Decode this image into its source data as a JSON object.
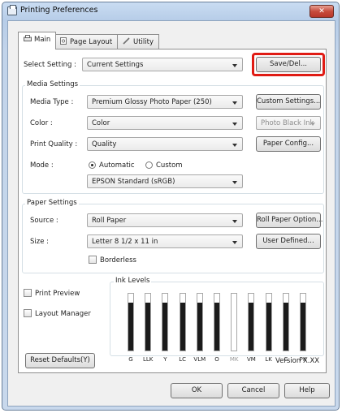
{
  "window": {
    "title": "Printing Preferences",
    "close_glyph": "✕"
  },
  "tabs": [
    {
      "label": "Main",
      "icon": "printer-icon"
    },
    {
      "label": "Page Layout",
      "icon": "page-layout-icon"
    },
    {
      "label": "Utility",
      "icon": "wrench-icon"
    }
  ],
  "select_setting": {
    "label": "Select Setting :",
    "value": "Current Settings",
    "save_del": "Save/Del..."
  },
  "media_settings": {
    "title": "Media Settings",
    "media_type_label": "Media Type :",
    "media_type_value": "Premium Glossy Photo Paper (250)",
    "custom_settings": "Custom Settings...",
    "color_label": "Color :",
    "color_value": "Color",
    "black_ink_value": "Photo Black Ink",
    "print_quality_label": "Print Quality :",
    "print_quality_value": "Quality",
    "paper_config": "Paper Config...",
    "mode_label": "Mode :",
    "mode_automatic": "Automatic",
    "mode_custom": "Custom",
    "mode_value": "EPSON Standard (sRGB)"
  },
  "paper_settings": {
    "title": "Paper Settings",
    "source_label": "Source :",
    "source_value": "Roll Paper",
    "roll_paper_option": "Roll Paper Option...",
    "size_label": "Size :",
    "size_value": "Letter 8 1/2 x 11 in",
    "user_defined": "User Defined...",
    "borderless": "Borderless"
  },
  "options": {
    "print_preview": "Print Preview",
    "layout_manager": "Layout Manager"
  },
  "ink_levels": {
    "title": "Ink Levels",
    "inks": [
      {
        "label": "G",
        "level": 0.85,
        "color": "#1b1b1b",
        "disabled": false
      },
      {
        "label": "LLK",
        "level": 0.85,
        "color": "#1b1b1b",
        "disabled": false
      },
      {
        "label": "Y",
        "level": 0.85,
        "color": "#1b1b1b",
        "disabled": false
      },
      {
        "label": "LC",
        "level": 0.85,
        "color": "#1b1b1b",
        "disabled": false
      },
      {
        "label": "VLM",
        "level": 0.85,
        "color": "#1b1b1b",
        "disabled": false
      },
      {
        "label": "O",
        "level": 0.85,
        "color": "#1b1b1b",
        "disabled": false
      },
      {
        "label": "MK",
        "level": 0.0,
        "color": "#1b1b1b",
        "disabled": true
      },
      {
        "label": "VM",
        "level": 0.85,
        "color": "#1b1b1b",
        "disabled": false
      },
      {
        "label": "LK",
        "level": 0.85,
        "color": "#1b1b1b",
        "disabled": false
      },
      {
        "label": "C",
        "level": 0.85,
        "color": "#1b1b1b",
        "disabled": false
      },
      {
        "label": "PK",
        "level": 0.85,
        "color": "#1b1b1b",
        "disabled": false
      }
    ]
  },
  "footer": {
    "reset_defaults": "Reset Defaults(Y)",
    "version": "Version X.XX"
  },
  "dialog_buttons": {
    "ok": "OK",
    "cancel": "Cancel",
    "help": "Help"
  },
  "colors": {
    "highlight": "#e01b14",
    "title_bar": "#c9dcf2"
  }
}
